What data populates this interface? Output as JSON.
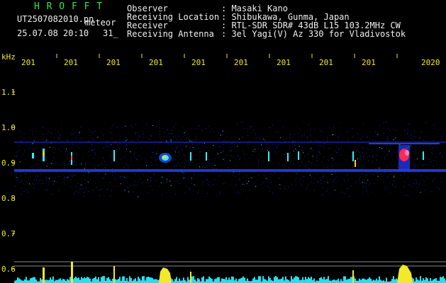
{
  "header": {
    "logo": "H R O F F T",
    "filename": "UT2507082010.pn",
    "suffix": "meteor",
    "datetime": "25.07.08 20:10",
    "counter": "31_",
    "meta": [
      {
        "label": "Observer",
        "value": ": Masaki Kano"
      },
      {
        "label": "Receiving Location",
        "value": ": Shibukawa, Gunma, Japan"
      },
      {
        "label": "Receiver",
        "value": ": RTL-SDR SDR# 43dB L15 103.2MHz CW"
      },
      {
        "label": "Receiving Antenna",
        "value": ": 3el Yagi(V) Az 330 for Vladivostok"
      }
    ]
  },
  "spectrogram": {
    "y_unit": "kHz",
    "y_ticks": [
      "1.1",
      "1.0",
      "0.9",
      "0.8",
      "0.7",
      "0.6"
    ],
    "x_ticks": [
      "201",
      "201",
      "201",
      "201",
      "201",
      "201",
      "201",
      "201",
      "201",
      "2020"
    ],
    "colors": {
      "text_green": "#2ee84a",
      "text_yellow": "#f2e92a",
      "signal_blue": "#2a3cff",
      "peak_red": "#ff2a55",
      "histogram_cyan": "#22e0f0"
    }
  }
}
